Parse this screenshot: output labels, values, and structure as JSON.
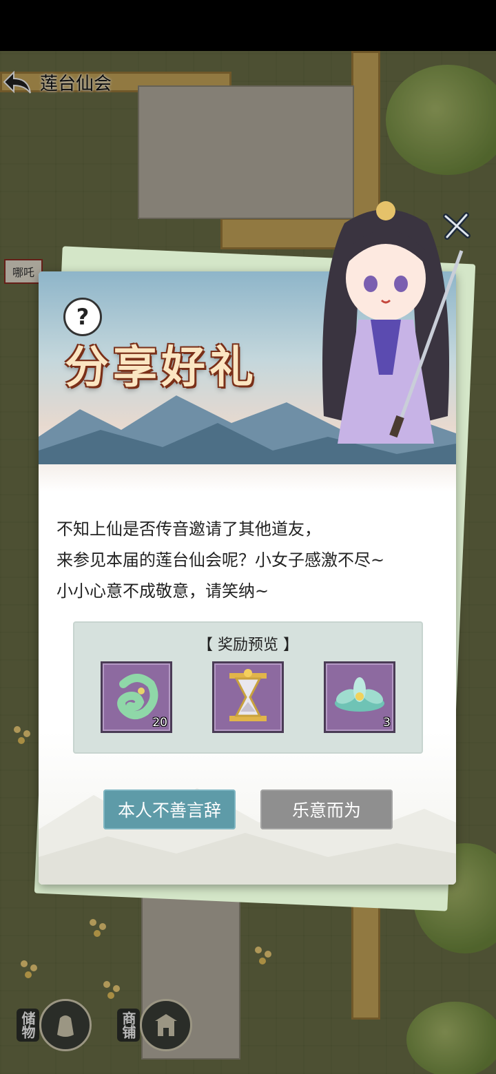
{
  "header": {
    "back_icon": "back-arrow-icon",
    "title": "莲台仙会"
  },
  "scene": {
    "npc_tag": "哪吒",
    "side_buttons": [
      {
        "label": "储物",
        "icon": "bag-icon"
      },
      {
        "label": "商铺",
        "icon": "shop-icon"
      }
    ]
  },
  "dialog": {
    "help_icon": "?",
    "banner_title": "分享好礼",
    "message_lines": [
      "不知上仙是否传音邀请了其他道友，",
      "来参见本届的莲台仙会呢？小女子感激不尽~",
      "小小心意不成敬意，请笑纳~"
    ],
    "reward_title": "【 奖励预览 】",
    "rewards": [
      {
        "icon": "jade-pendant-icon",
        "count": "20"
      },
      {
        "icon": "hourglass-icon",
        "count": ""
      },
      {
        "icon": "lotus-icon",
        "count": "3"
      }
    ],
    "decline_label": "本人不善言辞",
    "accept_label": "乐意而为",
    "close_icon": "close-x-icon"
  },
  "colors": {
    "decline_button": "#5e9ba8",
    "accept_button": "#8f8f8f",
    "reward_slot": "#8d6aa0",
    "banner_title": "#fbe6c2"
  }
}
